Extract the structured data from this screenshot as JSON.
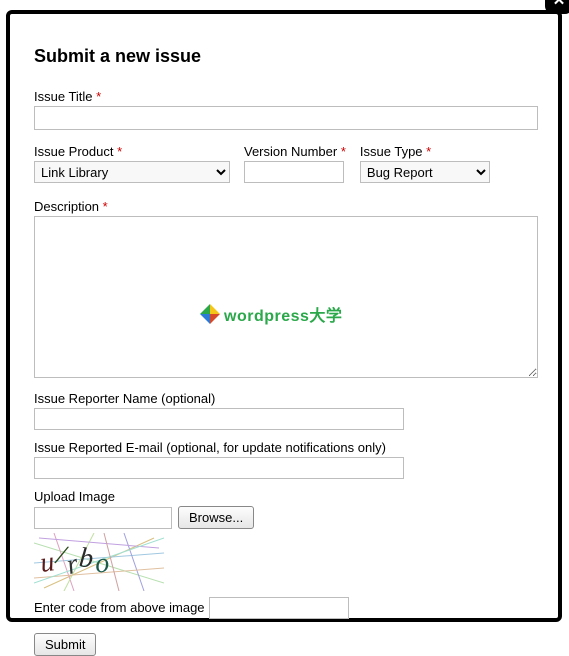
{
  "close_glyph": "✕",
  "title": "Submit a new issue",
  "required_marker": "*",
  "labels": {
    "issue_title": "Issue Title",
    "issue_product": "Issue Product",
    "version_number": "Version Number",
    "issue_type": "Issue Type",
    "description": "Description",
    "reporter_name": "Issue Reporter Name (optional)",
    "reporter_email": "Issue Reported E-mail (optional, for update notifications only)",
    "upload_image": "Upload Image",
    "enter_code": "Enter code from above image"
  },
  "values": {
    "issue_title": "",
    "issue_product_selected": "Link Library",
    "version_number": "",
    "issue_type_selected": "Bug Report",
    "description": "",
    "reporter_name": "",
    "reporter_email": "",
    "file_display": "",
    "code": ""
  },
  "buttons": {
    "browse": "Browse...",
    "submit": "Submit"
  },
  "captcha": {
    "chars": [
      "u",
      "/",
      "r",
      "b",
      "o"
    ]
  },
  "watermark": {
    "text": "wordpress大学"
  }
}
